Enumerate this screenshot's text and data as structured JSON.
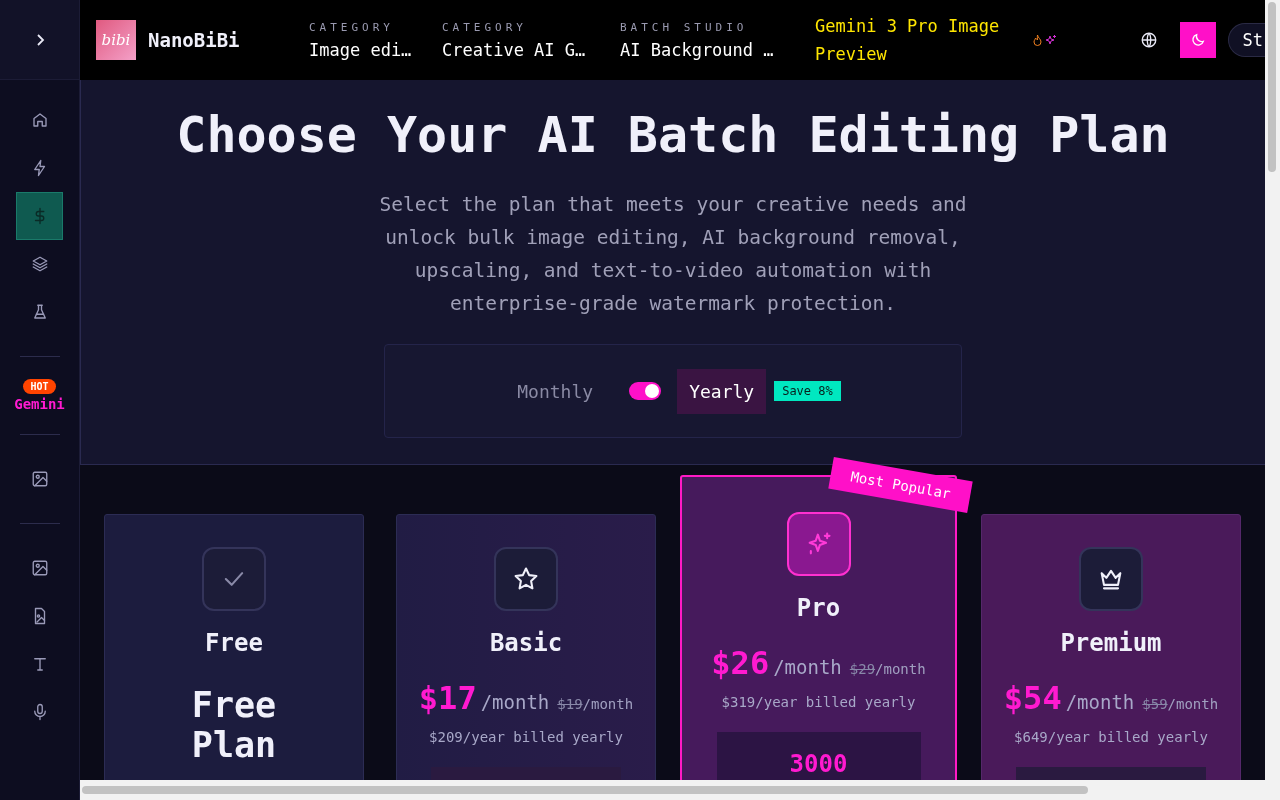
{
  "sidebar": {
    "items": [
      {
        "kind": "link",
        "selected": false
      },
      {
        "kind": "link",
        "selected": false
      },
      {
        "kind": "link",
        "selected": true
      },
      {
        "kind": "link",
        "selected": false
      },
      {
        "kind": "link",
        "selected": false
      },
      {
        "kind": "divider"
      },
      {
        "kind": "promo",
        "badge": "HOT",
        "label": "Gemini"
      },
      {
        "kind": "divider"
      },
      {
        "kind": "link",
        "selected": false
      },
      {
        "kind": "divider"
      },
      {
        "kind": "link",
        "selected": false
      },
      {
        "kind": "link",
        "selected": false
      },
      {
        "kind": "link",
        "selected": false
      },
      {
        "kind": "link",
        "selected": false
      }
    ]
  },
  "header": {
    "logo_text": "bibi",
    "brand": "NanoBiBi",
    "nav": [
      {
        "label": "CATEGORY",
        "value": "Image edi…"
      },
      {
        "label": "CATEGORY",
        "value": "Creative AI G…"
      },
      {
        "label": "BATCH STUDIO",
        "value": "AI Background …"
      }
    ],
    "promo": "Gemini 3 Pro Image Preview",
    "cut_button": "St"
  },
  "hero": {
    "title": "Choose Your AI Batch Editing Plan",
    "subtitle": "Select the plan that meets your creative needs and unlock bulk image editing, AI background removal, upscaling, and text-to-video automation with enterprise-grade watermark protection.",
    "billing": {
      "options": [
        {
          "label": "Monthly",
          "selected": false
        },
        {
          "label": "Yearly",
          "selected": true
        }
      ],
      "toggle_on": true,
      "save_badge": "Save 8%"
    }
  },
  "plans": [
    {
      "name": "Free",
      "featured": false,
      "plan_label": "Free Plan"
    },
    {
      "name": "Basic",
      "featured": false,
      "price": "$17",
      "per": "/month",
      "old_price": "$19",
      "old_per": "/month",
      "yearly": "$209/year billed yearly"
    },
    {
      "name": "Pro",
      "featured": true,
      "ribbon": "Most Popular",
      "price": "$26",
      "per": "/month",
      "old_price": "$29",
      "old_per": "/month",
      "yearly": "$319/year billed yearly",
      "credits": "3000"
    },
    {
      "name": "Premium",
      "featured": false,
      "price": "$54",
      "per": "/month",
      "old_price": "$59",
      "old_per": "/month",
      "yearly": "$649/year billed yearly"
    }
  ]
}
